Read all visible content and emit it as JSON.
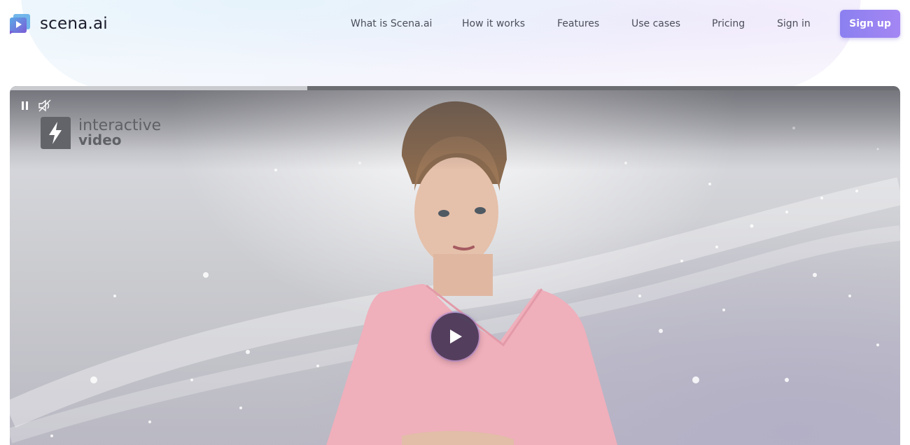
{
  "brand": {
    "name": "scena.ai"
  },
  "nav": {
    "links": [
      {
        "label": "What is Scena.ai"
      },
      {
        "label": "How it works"
      },
      {
        "label": "Features"
      },
      {
        "label": "Use cases"
      },
      {
        "label": "Pricing"
      },
      {
        "label": "Sign in"
      }
    ],
    "signup_label": "Sign up"
  },
  "video": {
    "progress": 0.334,
    "overlay_line1": "interactive",
    "overlay_line2": "video",
    "icons": [
      "pause-icon",
      "volume-muted-icon",
      "lightning-icon",
      "play-icon"
    ]
  },
  "colors": {
    "accent": "#8b80f0",
    "logo_purple": "#7b5bd6",
    "logo_blue": "#5aa9e6"
  }
}
